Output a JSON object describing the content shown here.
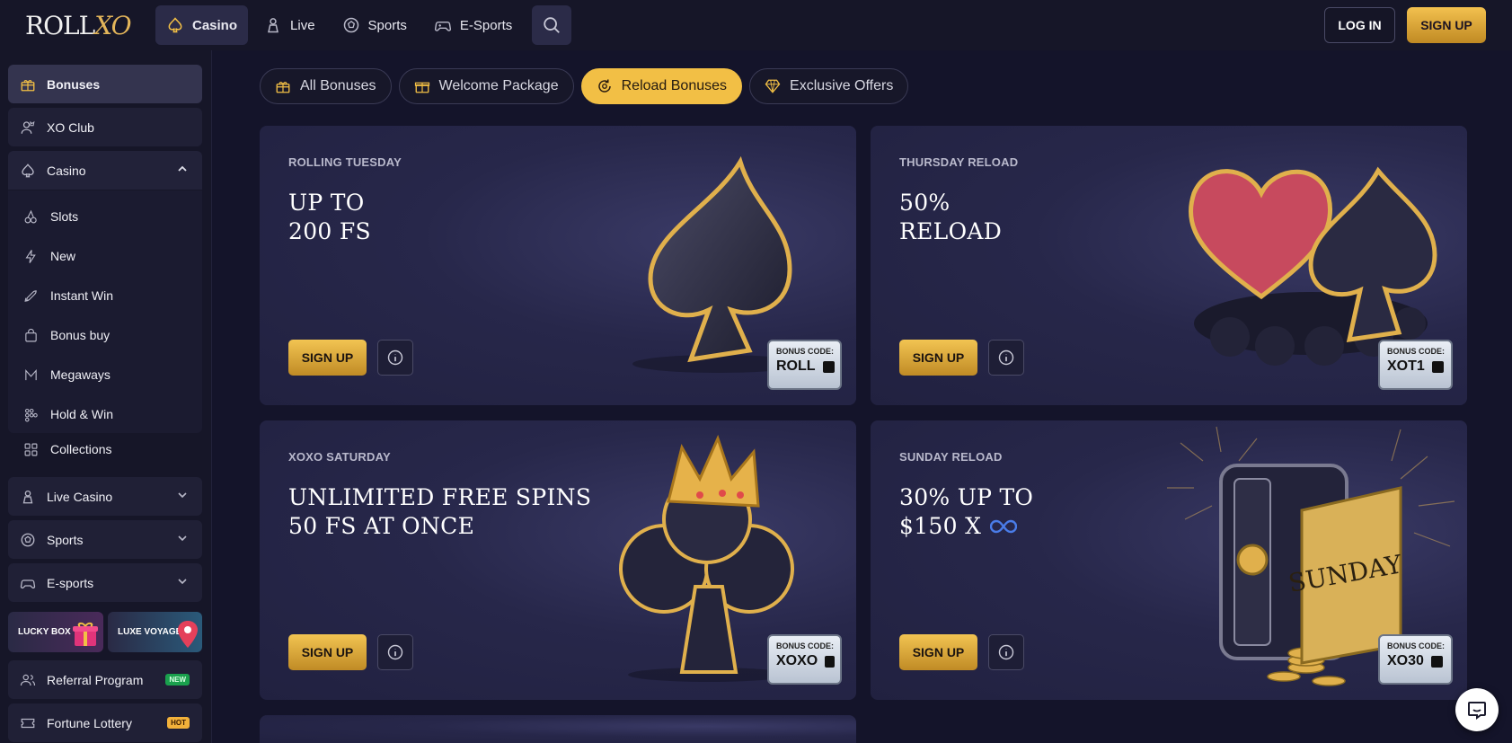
{
  "brand": {
    "logo_text_a": "ROLL",
    "logo_text_b": "XO"
  },
  "nav": {
    "items": [
      {
        "label": "Casino",
        "icon": "spade-icon",
        "active": true
      },
      {
        "label": "Live",
        "icon": "dealer-icon"
      },
      {
        "label": "Sports",
        "icon": "soccer-ball-icon"
      },
      {
        "label": "E-Sports",
        "icon": "gamepad-icon"
      }
    ],
    "search_icon": "search-icon",
    "login": "LOG IN",
    "signup": "SIGN UP"
  },
  "sidebar": {
    "items": {
      "bonuses": "Bonuses",
      "xo_club": "XO Club",
      "casino": "Casino",
      "live_casino": "Live Casino",
      "sports": "Sports",
      "esports": "E-sports",
      "referral": "Referral Program",
      "lottery": "Fortune Lottery"
    },
    "casino_sub": [
      "Slots",
      "New",
      "Instant Win",
      "Bonus buy",
      "Megaways",
      "Hold & Win",
      "Collections"
    ],
    "promos": {
      "lucky_box": "LUCKY BOX",
      "luxe_voyage": "LUXE VOYAGE"
    },
    "badges": {
      "new": "NEW",
      "hot": "HOT"
    }
  },
  "tabs": [
    {
      "label": "All Bonuses",
      "icon": "gift-icon"
    },
    {
      "label": "Welcome Package",
      "icon": "gift-box-icon"
    },
    {
      "label": "Reload Bonuses",
      "icon": "reload-icon",
      "active": true
    },
    {
      "label": "Exclusive Offers",
      "icon": "diamond-icon"
    }
  ],
  "cards": [
    {
      "kicker": "ROLLING TUESDAY",
      "line1": "UP TO",
      "line2": "200 FS",
      "signup": "SIGN UP",
      "code_label": "BONUS CODE:",
      "code": "ROLL"
    },
    {
      "kicker": "THURSDAY RELOAD",
      "line1": "50%",
      "line2": "RELOAD",
      "signup": "SIGN UP",
      "code_label": "BONUS CODE:",
      "code": "XOT1"
    },
    {
      "kicker": "XOXO SATURDAY",
      "line1": "UNLIMITED FREE SPINS",
      "line2": "50 FS AT ONCE",
      "signup": "SIGN UP",
      "code_label": "BONUS CODE:",
      "code": "XOXO"
    },
    {
      "kicker": "SUNDAY RELOAD",
      "line1": "30% UP TO",
      "line2": "$150 X",
      "signup": "SIGN UP",
      "code_label": "BONUS CODE:",
      "code": "XO30",
      "art_text": "SUNDAY"
    }
  ],
  "colors": {
    "accent": "#f2bf45",
    "bg": "#14142a",
    "card": "#27274a"
  }
}
